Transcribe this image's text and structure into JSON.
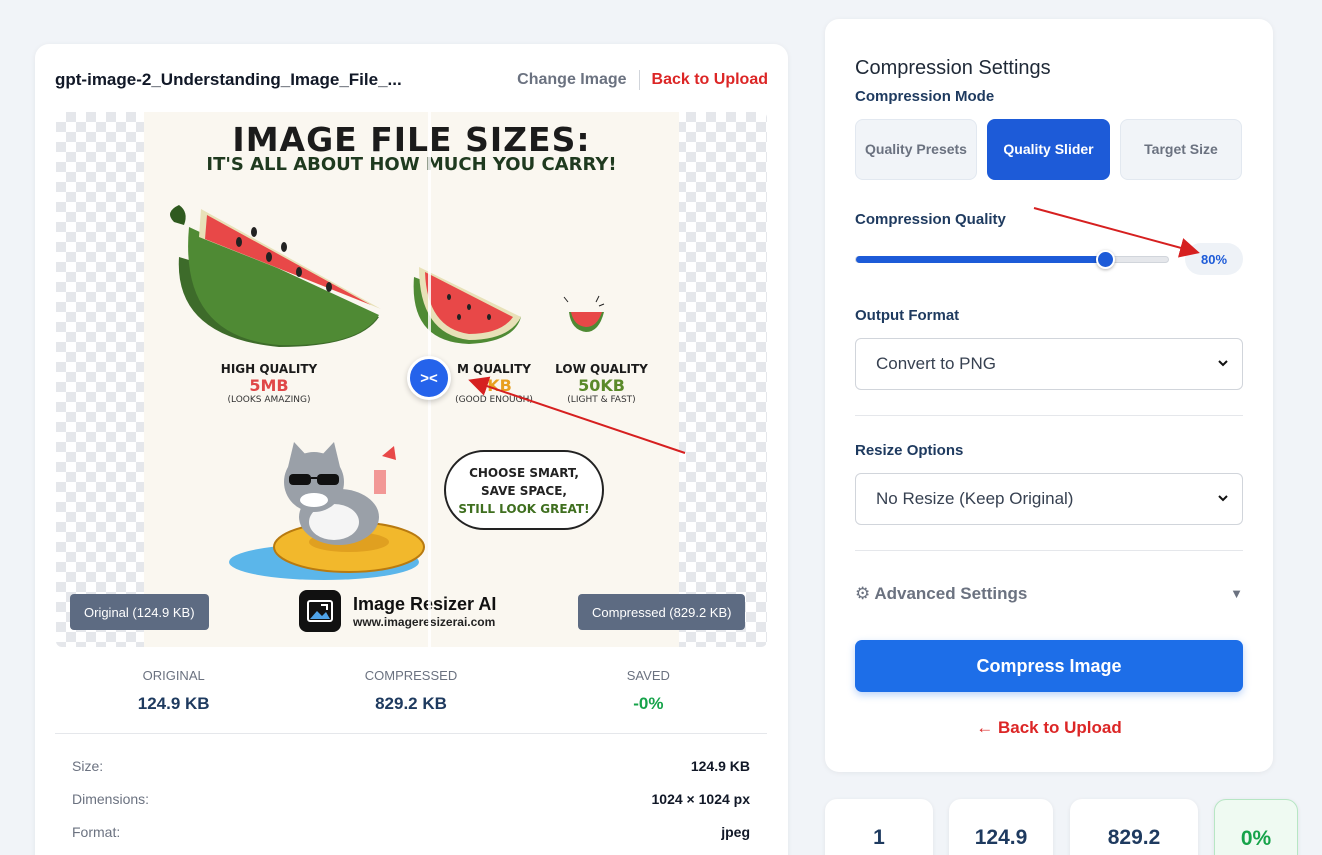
{
  "file": {
    "name": "gpt-image-2_Understanding_Image_File_...",
    "change_label": "Change Image",
    "back_label": "Back to Upload"
  },
  "poster": {
    "title": "IMAGE FILE SIZES:",
    "subtitle": "IT'S ALL ABOUT HOW MUCH YOU CARRY!",
    "tiers": [
      {
        "name": "HIGH QUALITY",
        "size": "5MB",
        "note": "(LOOKS AMAZING)",
        "color": "#e04848"
      },
      {
        "name": "M QUALITY",
        "size": "0KB",
        "note": "(GOOD ENOUGH)",
        "color": "#e8a020"
      },
      {
        "name": "LOW QUALITY",
        "size": "50KB",
        "note": "(LIGHT & FAST)",
        "color": "#5a8a2a"
      }
    ],
    "bubble_line1": "CHOOSE SMART,",
    "bubble_line2": "SAVE SPACE,",
    "bubble_line3": "STILL LOOK GREAT!",
    "brand_name": "Image Resizer AI",
    "brand_url": "www.imageresizerai.com"
  },
  "compare": {
    "original_tag": "Original (124.9 KB)",
    "compressed_tag": "Compressed (829.2 KB)"
  },
  "stats": {
    "original_label": "ORIGINAL",
    "original_value": "124.9 KB",
    "compressed_label": "COMPRESSED",
    "compressed_value": "829.2 KB",
    "saved_label": "SAVED",
    "saved_value": "-0%"
  },
  "info": {
    "size_label": "Size:",
    "size_value": "124.9 KB",
    "dim_label": "Dimensions:",
    "dim_value": "1024 × 1024 px",
    "format_label": "Format:",
    "format_value": "jpeg"
  },
  "settings": {
    "title": "Compression Settings",
    "mode_label": "Compression Mode",
    "modes": [
      "Quality Presets",
      "Quality Slider",
      "Target Size"
    ],
    "active_mode": "Quality Slider",
    "quality_label": "Compression Quality",
    "quality_value": 0.8,
    "quality_text": "80%",
    "format_label": "Output Format",
    "format_selected": "Convert to PNG",
    "resize_label": "Resize Options",
    "resize_selected": "No Resize (Keep Original)",
    "advanced_label": "⚙ Advanced Settings",
    "compress_button": "Compress Image",
    "back_link": "← Back to Upload"
  },
  "summary_cards": [
    "1",
    "124.9",
    "829.2",
    "0%"
  ],
  "colors": {
    "accent": "#1d5bd8",
    "danger": "#dc2626",
    "success": "#16a34a",
    "annotation": "#d62020"
  }
}
